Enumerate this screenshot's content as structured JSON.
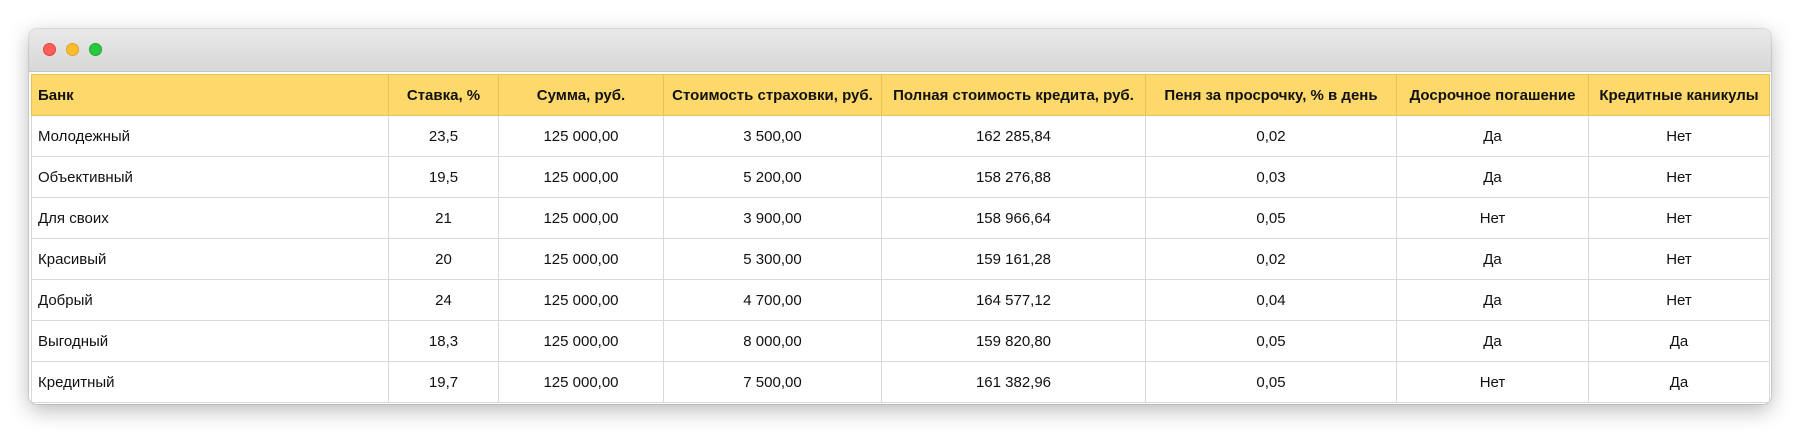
{
  "window": {
    "controls": [
      "close",
      "minimize",
      "maximize"
    ]
  },
  "colors": {
    "header_bg": "#fdd86a",
    "close": "#ff5f57",
    "minimize": "#febc2e",
    "maximize": "#28c840"
  },
  "table": {
    "headers": [
      "Банк",
      "Ставка, %",
      "Сумма, руб.",
      "Стоимость страховки, руб.",
      "Полная стоимость кредита, руб.",
      "Пеня за просрочку, % в день",
      "Досрочное погашение",
      "Кредитные каникулы"
    ],
    "rows": [
      [
        "Молодежный",
        "23,5",
        "125 000,00",
        "3 500,00",
        "162 285,84",
        "0,02",
        "Да",
        "Нет"
      ],
      [
        "Объективный",
        "19,5",
        "125 000,00",
        "5 200,00",
        "158 276,88",
        "0,03",
        "Да",
        "Нет"
      ],
      [
        "Для своих",
        "21",
        "125 000,00",
        "3 900,00",
        "158 966,64",
        "0,05",
        "Нет",
        "Нет"
      ],
      [
        "Красивый",
        "20",
        "125 000,00",
        "5 300,00",
        "159 161,28",
        "0,02",
        "Да",
        "Нет"
      ],
      [
        "Добрый",
        "24",
        "125 000,00",
        "4 700,00",
        "164 577,12",
        "0,04",
        "Да",
        "Нет"
      ],
      [
        "Выгодный",
        "18,3",
        "125 000,00",
        "8 000,00",
        "159 820,80",
        "0,05",
        "Да",
        "Да"
      ],
      [
        "Кредитный",
        "19,7",
        "125 000,00",
        "7 500,00",
        "161 382,96",
        "0,05",
        "Нет",
        "Да"
      ]
    ]
  }
}
